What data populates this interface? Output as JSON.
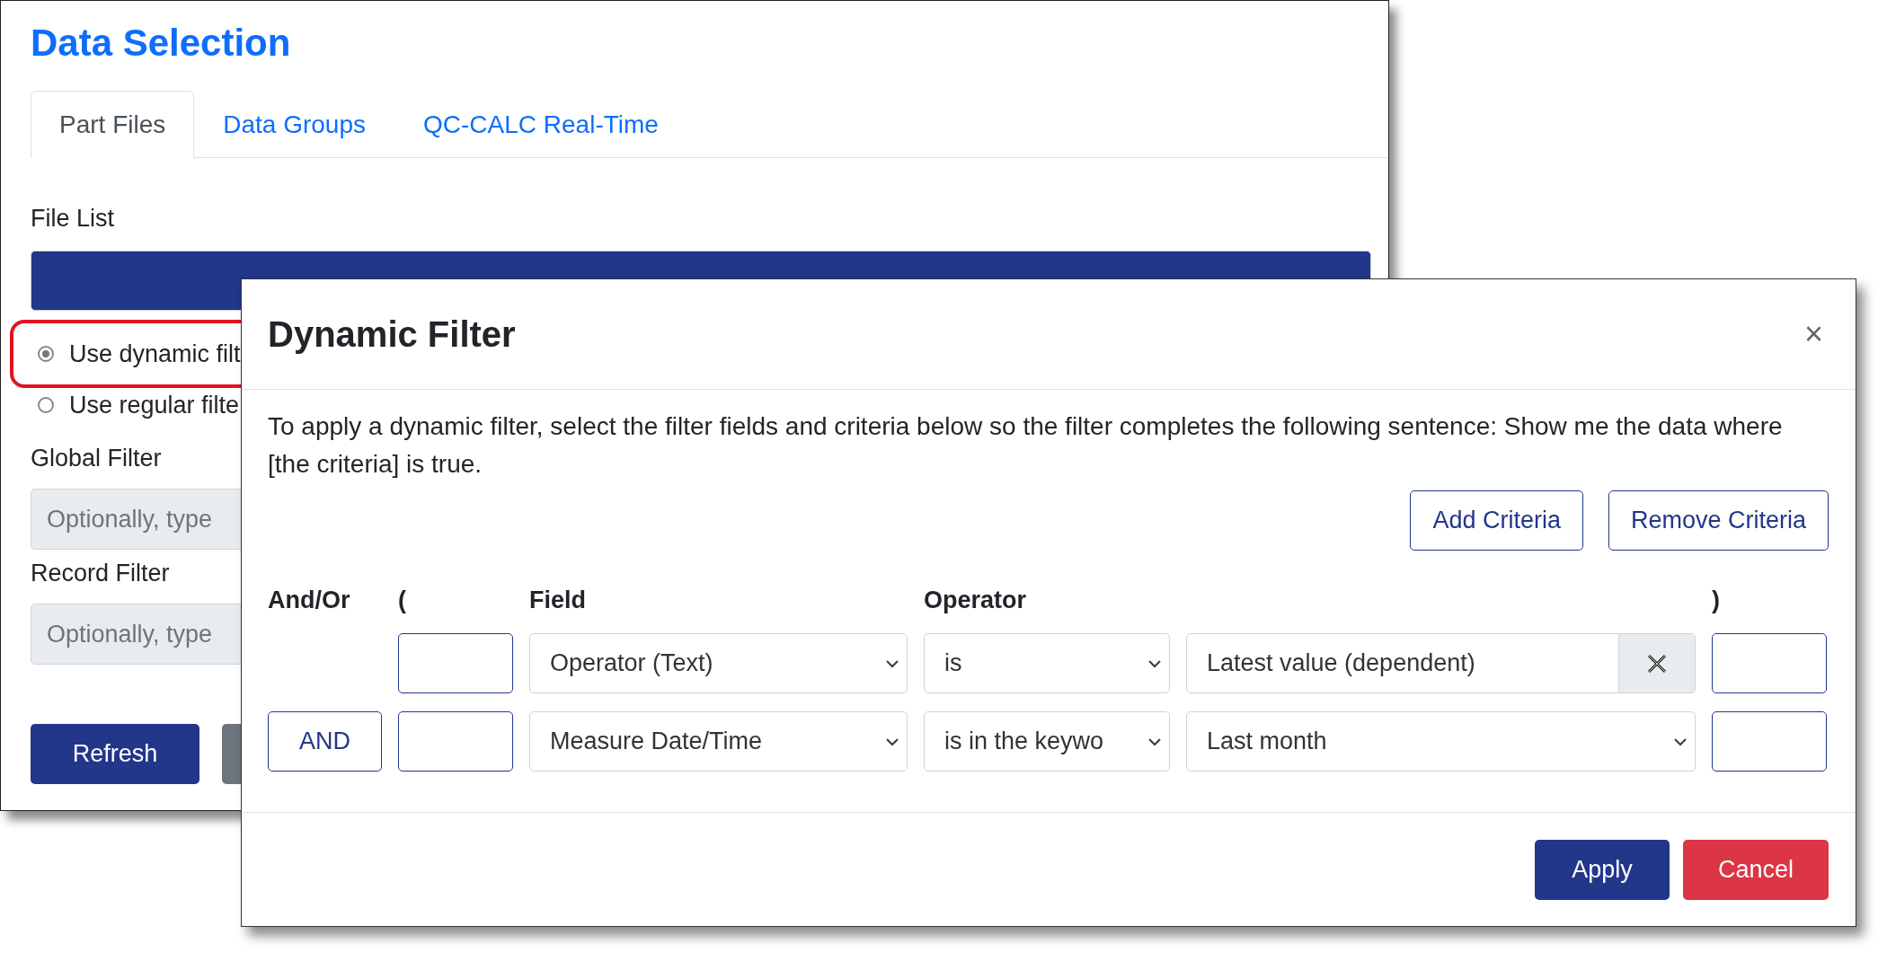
{
  "window": {
    "title": "Data Selection"
  },
  "tabs": [
    {
      "label": "Part Files",
      "selected": true
    },
    {
      "label": "Data Groups",
      "selected": false
    },
    {
      "label": "QC-CALC Real-Time",
      "selected": false
    }
  ],
  "file_list": {
    "label": "File List",
    "items": [
      {
        "selected": true
      }
    ]
  },
  "filter_mode": [
    {
      "label": "Use dynamic filt",
      "selected": true,
      "highlighted": true
    },
    {
      "label": "Use regular filte",
      "selected": false,
      "highlighted": false
    }
  ],
  "global_filter": {
    "label": "Global Filter",
    "placeholder": "Optionally, type"
  },
  "record_filter": {
    "label": "Record Filter",
    "placeholder": "Optionally, type"
  },
  "buttons": [
    {
      "label": "Refresh",
      "kind": "primary"
    },
    {
      "kind": "secondary"
    }
  ],
  "dialog": {
    "title": "Dynamic Filter",
    "close": "×",
    "description": "To apply a dynamic filter, select the filter fields and criteria below so the filter completes the following sentence: Show me the data where [the criteria] is true.",
    "actions": [
      "Add Criteria",
      "Remove Criteria"
    ],
    "columns": {
      "and_or": "And/Or",
      "open_paren": "(",
      "field": "Field",
      "operator": "Operator",
      "close_paren": ")"
    },
    "criteria": [
      {
        "kind": "text",
        "field": "Operator (Text)",
        "operator": "is",
        "value": "Latest value (dependent)"
      },
      {
        "kind": "select",
        "conjunction": "AND",
        "field": "Measure Date/Time",
        "operator": "is in the keywo",
        "value": "Last month"
      }
    ],
    "footer_buttons": [
      {
        "label": "Apply",
        "kind": "primary"
      },
      {
        "label": "Cancel",
        "kind": "danger"
      }
    ]
  }
}
